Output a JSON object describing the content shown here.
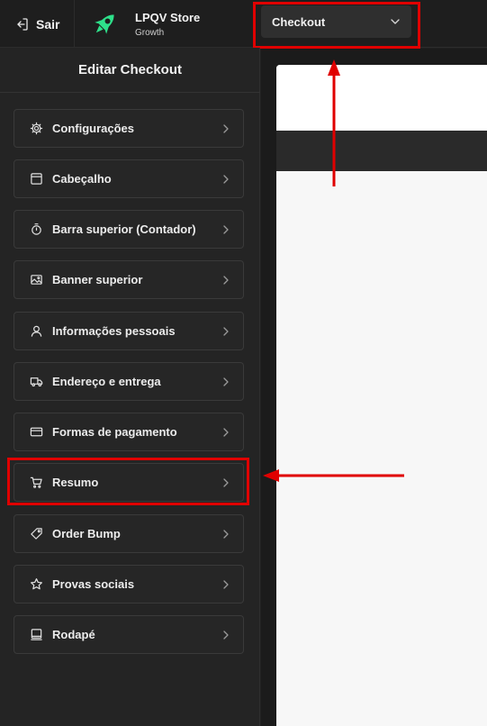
{
  "topbar": {
    "exit_label": "Sair",
    "store_name": "LPQV Store",
    "store_plan": "Growth",
    "page_select": {
      "selected": "Checkout"
    }
  },
  "sidebar": {
    "title": "Editar Checkout",
    "items": [
      {
        "label": "Configurações",
        "icon": "gear-icon"
      },
      {
        "label": "Cabeçalho",
        "icon": "window-icon"
      },
      {
        "label": "Barra superior (Contador)",
        "icon": "timer-icon"
      },
      {
        "label": "Banner superior",
        "icon": "image-icon"
      },
      {
        "label": "Informações pessoais",
        "icon": "user-icon"
      },
      {
        "label": "Endereço e entrega",
        "icon": "truck-icon"
      },
      {
        "label": "Formas de pagamento",
        "icon": "credit-card-icon"
      },
      {
        "label": "Resumo",
        "icon": "cart-icon"
      },
      {
        "label": "Order Bump",
        "icon": "tag-icon"
      },
      {
        "label": "Provas sociais",
        "icon": "star-icon"
      },
      {
        "label": "Rodapé",
        "icon": "laptop-icon"
      }
    ]
  },
  "colors": {
    "highlight": "#e00000",
    "brand_logo": "#2ee08a",
    "background": "#202020"
  }
}
